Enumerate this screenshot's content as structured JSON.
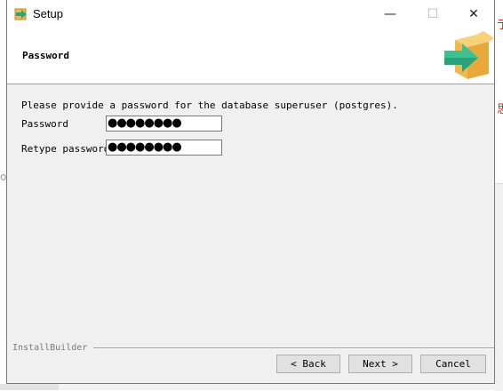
{
  "window": {
    "title": "Setup",
    "controls": {
      "minimize": "—",
      "maximize": "☐",
      "close": "✕"
    }
  },
  "header": {
    "title": "Password",
    "logo_icon": "installer-box-arrow-icon"
  },
  "main": {
    "instruction": "Please provide a password for the database superuser (postgres).",
    "fields": [
      {
        "label": "Password",
        "value": "●●●●●●●●"
      },
      {
        "label": "Retype password",
        "value": "●●●●●●●●"
      }
    ]
  },
  "footer": {
    "brand": "InstallBuilder",
    "buttons": {
      "back": "< Back",
      "next": "Next >",
      "cancel": "Cancel"
    }
  },
  "colors": {
    "window_bg": "#f0f0f0",
    "header_bg": "#ffffff",
    "box_orange": "#f2b84b",
    "arrow_teal": "#2aa37a"
  }
}
